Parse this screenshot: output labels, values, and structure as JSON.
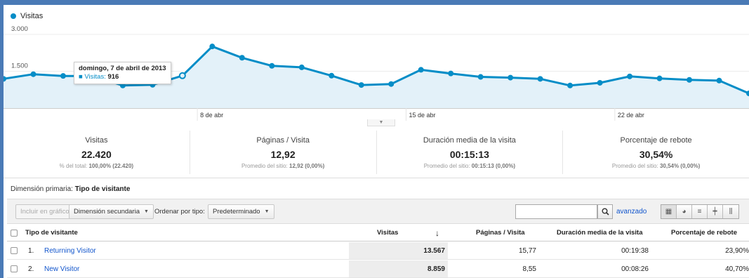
{
  "chart": {
    "legend_label": "Visitas",
    "y_ticks": [
      "3.000",
      "1.500"
    ],
    "x_labels": [
      "8 de abr",
      "15 de abr",
      "22 de abr"
    ],
    "tooltip": {
      "date": "domingo, 7 de abril de 2013",
      "metric_label": "Visitas:",
      "metric_value": "916"
    },
    "accent_color": "#058dc7",
    "fill_color": "#e3f1f9",
    "chart_data": {
      "type": "area",
      "series": [
        {
          "name": "Visitas",
          "values": [
            1190,
            1380,
            1310,
            1310,
            920,
            950,
            1320,
            2510,
            2050,
            1720,
            1660,
            1320,
            940,
            980,
            1560,
            1410,
            1270,
            1240,
            1190,
            920,
            1030,
            1290,
            1210,
            1150,
            1120,
            600
          ]
        }
      ],
      "ylim": [
        0,
        3000
      ],
      "grid": true
    }
  },
  "summary": [
    {
      "label": "Visitas",
      "value": "22.420",
      "sub_text": "% del total: ",
      "sub_bold": "100,00% (22.420)"
    },
    {
      "label": "Páginas / Visita",
      "value": "12,92",
      "sub_text": "Promedio del sitio: ",
      "sub_bold": "12,92 (0,00%)"
    },
    {
      "label": "Duración media de la visita",
      "value": "00:15:13",
      "sub_text": "Promedio del sitio: ",
      "sub_bold": "00:15:13 (0,00%)"
    },
    {
      "label": "Porcentaje de rebote",
      "value": "30,54%",
      "sub_text": "Promedio del sitio: ",
      "sub_bold": "30,54% (0,00%)"
    }
  ],
  "dimension": {
    "label": "Dimensión primaria:",
    "value": "Tipo de visitante"
  },
  "toolbar": {
    "plot_button": "Incluir en gráfico",
    "secondary_dimension": "Dimensión secundaria",
    "sort_label": "Ordenar por tipo:",
    "sort_value": "Predeterminado",
    "search_placeholder": "",
    "advanced_link": "avanzado"
  },
  "table": {
    "headers": {
      "type": "Tipo de visitante",
      "visits": "Visitas",
      "pages": "Páginas / Visita",
      "duration": "Duración media de la visita",
      "bounce": "Porcentaje de rebote"
    },
    "rows": [
      {
        "num": "1.",
        "name": "Returning Visitor",
        "visits": "13.567",
        "pages": "15,77",
        "duration": "00:19:38",
        "bounce": "23,90%"
      },
      {
        "num": "2.",
        "name": "New Visitor",
        "visits": "8.859",
        "pages": "8,55",
        "duration": "00:08:26",
        "bounce": "40,70%"
      }
    ]
  }
}
